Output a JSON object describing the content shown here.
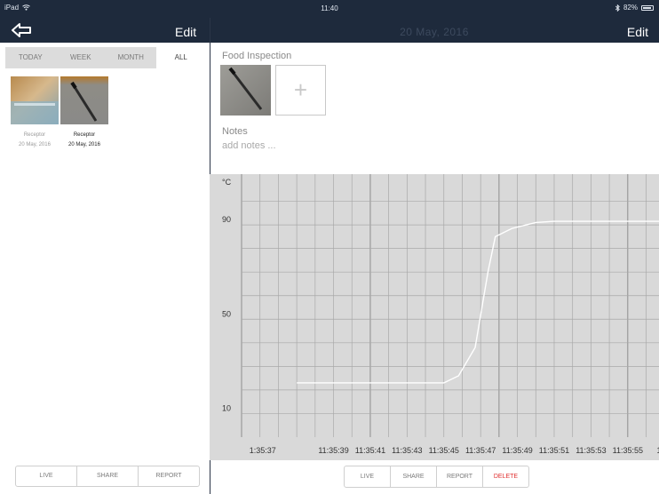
{
  "status": {
    "device": "iPad",
    "time": "11:40",
    "battery": "82%"
  },
  "nav": {
    "left_edit": "Edit",
    "title": "20 May, 2016",
    "right_edit": "Edit"
  },
  "filters": [
    {
      "label": "TODAY",
      "active": false
    },
    {
      "label": "WEEK",
      "active": false
    },
    {
      "label": "MONTH",
      "active": false
    },
    {
      "label": "ALL",
      "active": true
    }
  ],
  "thumbnails": [
    {
      "name": "Receptor",
      "date": "20 May, 2016",
      "selected": false
    },
    {
      "name": "Receptor",
      "date": "20 May, 2016",
      "selected": true
    }
  ],
  "left_toolbar": {
    "live": "LIVE",
    "share": "SHARE",
    "report": "REPORT"
  },
  "detail": {
    "section_title": "Food Inspection",
    "notes_label": "Notes",
    "notes_placeholder": "add notes ..."
  },
  "right_toolbar": {
    "live": "LIVE",
    "share": "SHARE",
    "report": "REPORT",
    "delete": "DELETE"
  },
  "colors": {
    "nav_bg": "#1e2a3c",
    "chart_bg": "#d9d9d9",
    "line": "#ffffff",
    "delete": "#e03030"
  },
  "chart_data": {
    "type": "line",
    "unit_label": "°C",
    "y_ticks": [
      90,
      50,
      10
    ],
    "ylim": [
      0,
      110
    ],
    "x_tick_labels": [
      "1:35:37",
      "11:35:39",
      "11:35:41",
      "11:35:43",
      "11:35:45",
      "11:35:47",
      "11:35:49",
      "11:35:51",
      "11:35:53",
      "11:35:55",
      "1"
    ],
    "x_tick_values": [
      35.15,
      39,
      41,
      43,
      45,
      47,
      49,
      51,
      53,
      55,
      56.7
    ],
    "x_range": [
      34,
      56.7
    ],
    "series": [
      {
        "x": [
          37,
          45,
          45.8,
          46.7,
          47.4,
          47.8,
          48.7,
          50,
          51,
          53,
          56.7
        ],
        "y": [
          23,
          23,
          26,
          38,
          70,
          85,
          88.5,
          91,
          91.5,
          91.5,
          91.5
        ]
      }
    ]
  }
}
